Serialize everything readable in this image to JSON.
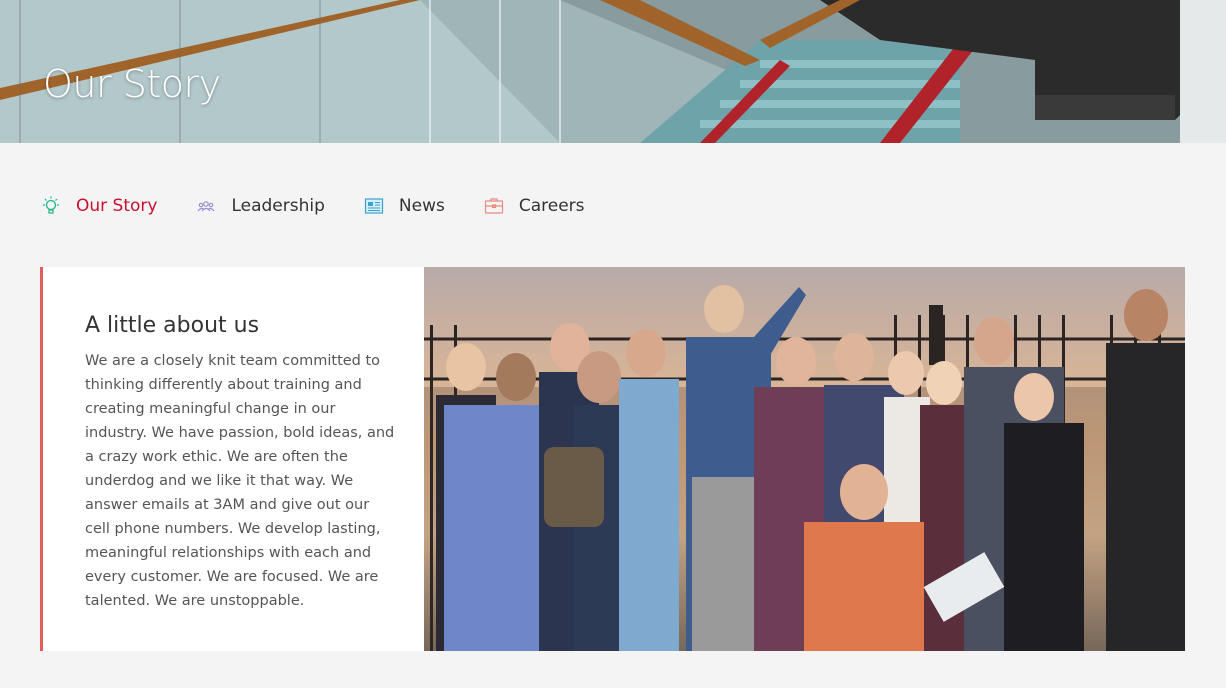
{
  "hero": {
    "title": "Our Story"
  },
  "subnav": {
    "items": [
      {
        "label": "Our Story",
        "icon": "lightbulb-icon",
        "active": true
      },
      {
        "label": "Leadership",
        "icon": "people-icon",
        "active": false
      },
      {
        "label": "News",
        "icon": "newspaper-icon",
        "active": false
      },
      {
        "label": "Careers",
        "icon": "briefcase-icon",
        "active": false
      }
    ]
  },
  "about": {
    "title": "A little about us",
    "body": "We are a closely knit team committed to thinking differently about training and creating meaningful change in our industry. We have passion, bold ideas, and a crazy work ethic. We are often the underdog and we like it that way. We answer emails at 3AM and give out our cell phone numbers. We develop lasting, meaningful relationships with each and every customer. We are focused. We are talented. We are unstoppable."
  },
  "colors": {
    "accent": "#c8102e",
    "card_border": "#e35d5d"
  }
}
